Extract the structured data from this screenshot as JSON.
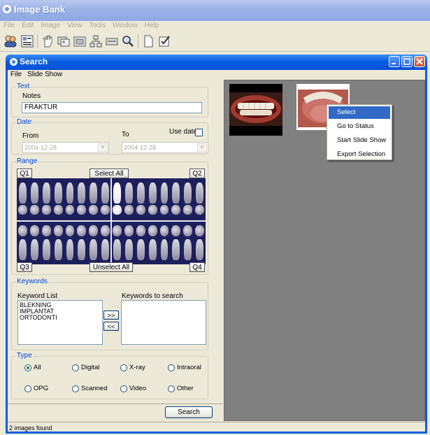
{
  "app": {
    "title": "Image Bank"
  },
  "main_menu": [
    "File",
    "Edit",
    "Image",
    "View",
    "Tools",
    "Window",
    "Help"
  ],
  "toolbar_icons": [
    "users-icon",
    "list-icon",
    "hand-icon",
    "images-icon",
    "image-icon",
    "network-icon",
    "scanner-icon",
    "search-icon",
    "document-icon",
    "checklist-icon"
  ],
  "search_window": {
    "title": "Search",
    "menu": [
      "File",
      "Slide Show"
    ],
    "text_group": {
      "legend": "Text",
      "notes_label": "Notes",
      "notes_value": "FRAKTUR"
    },
    "date_group": {
      "legend": "Date",
      "from_label": "From",
      "to_label": "To",
      "use_date_label": "Use date",
      "from_value": "2004-12-28",
      "to_value": "2004-12-28"
    },
    "range_group": {
      "legend": "Range",
      "q1": "Q1",
      "q2": "Q2",
      "q3": "Q3",
      "q4": "Q4",
      "select_all": "Select All",
      "unselect_all": "Unselect All"
    },
    "keywords_group": {
      "legend": "Keywords",
      "list_label": "Keyword List",
      "search_label": "Keywords to search",
      "keywords": [
        "BLEKNING",
        "IMPLANTAT",
        "ORTODONTI"
      ],
      "add_button": ">>",
      "remove_button": "<<"
    },
    "type_group": {
      "legend": "Type",
      "options": [
        "All",
        "Digital",
        "X-ray",
        "Intraoral",
        "OPG",
        "Scanned",
        "Video",
        "Other"
      ],
      "selected": "All"
    },
    "search_button": "Search",
    "status": "2 images found"
  },
  "context_menu": {
    "items": [
      "Select",
      "Go to Status",
      "Start Slide Show",
      "Export Selection"
    ],
    "highlighted": "Select"
  },
  "colors": {
    "title_bar": "#0A5EE2",
    "legend_text": "#0046D5",
    "highlight": "#316AC5",
    "thumb_background": "#808080",
    "teeth_background": "#1D1F5C"
  }
}
